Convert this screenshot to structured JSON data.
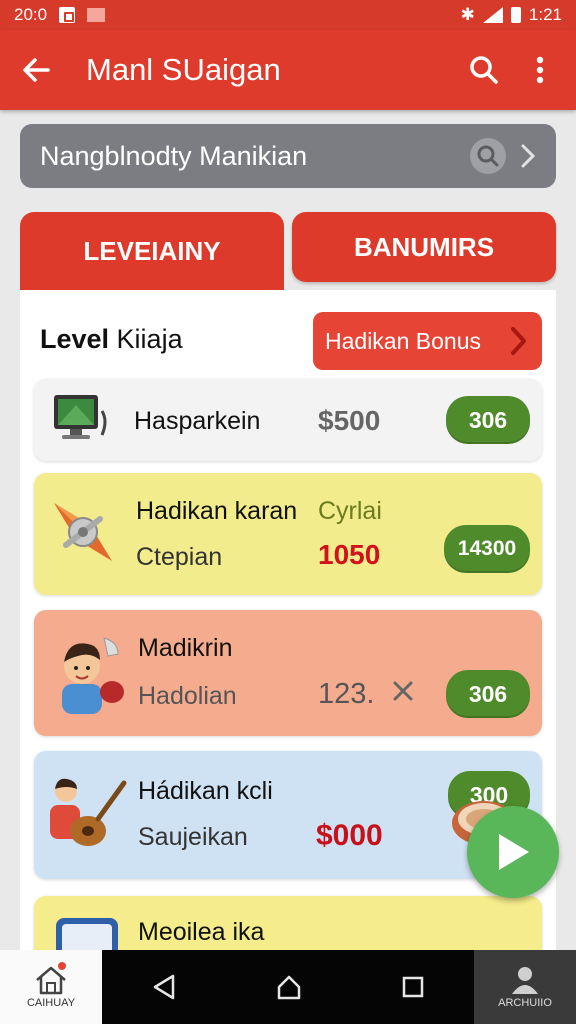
{
  "status_bar": {
    "time": "20:0",
    "clock": "1:21"
  },
  "app_bar": {
    "title": "Manl SUaigan"
  },
  "search": {
    "text": "Nangblnodty Manikian"
  },
  "tabs": [
    {
      "label": "LEVEIAINY"
    },
    {
      "label": "BANUMIRS"
    }
  ],
  "level": {
    "title_bold": "Level",
    "title_rest": " Kiiaja",
    "bonus_label": "Hadikan Bonus"
  },
  "items": [
    {
      "name": "Hasparkein",
      "price": "$500",
      "badge": "306",
      "price_color": "#555555"
    },
    {
      "name": "Hadikan karan",
      "tag": "Cyrlai",
      "sub": "Ctepian",
      "price": "1050",
      "badge": "14300",
      "price_color": "#d1121b"
    },
    {
      "name": "Madikrin",
      "sub": "Hadolian",
      "price": "123.",
      "badge": "306",
      "price_color": "#555555"
    },
    {
      "name": "Hádikan kcli",
      "sub": "Saujeikan",
      "price": "$000",
      "badge": "300",
      "price_color": "#c8101a"
    },
    {
      "name": "Meoilea ika"
    }
  ],
  "nav": {
    "home_label": "CAIHUAY",
    "profile_label": "ARCHUIIO"
  },
  "colors": {
    "primary": "#df3b2c",
    "badge": "#4f8a2b",
    "fab": "#59b75a"
  }
}
